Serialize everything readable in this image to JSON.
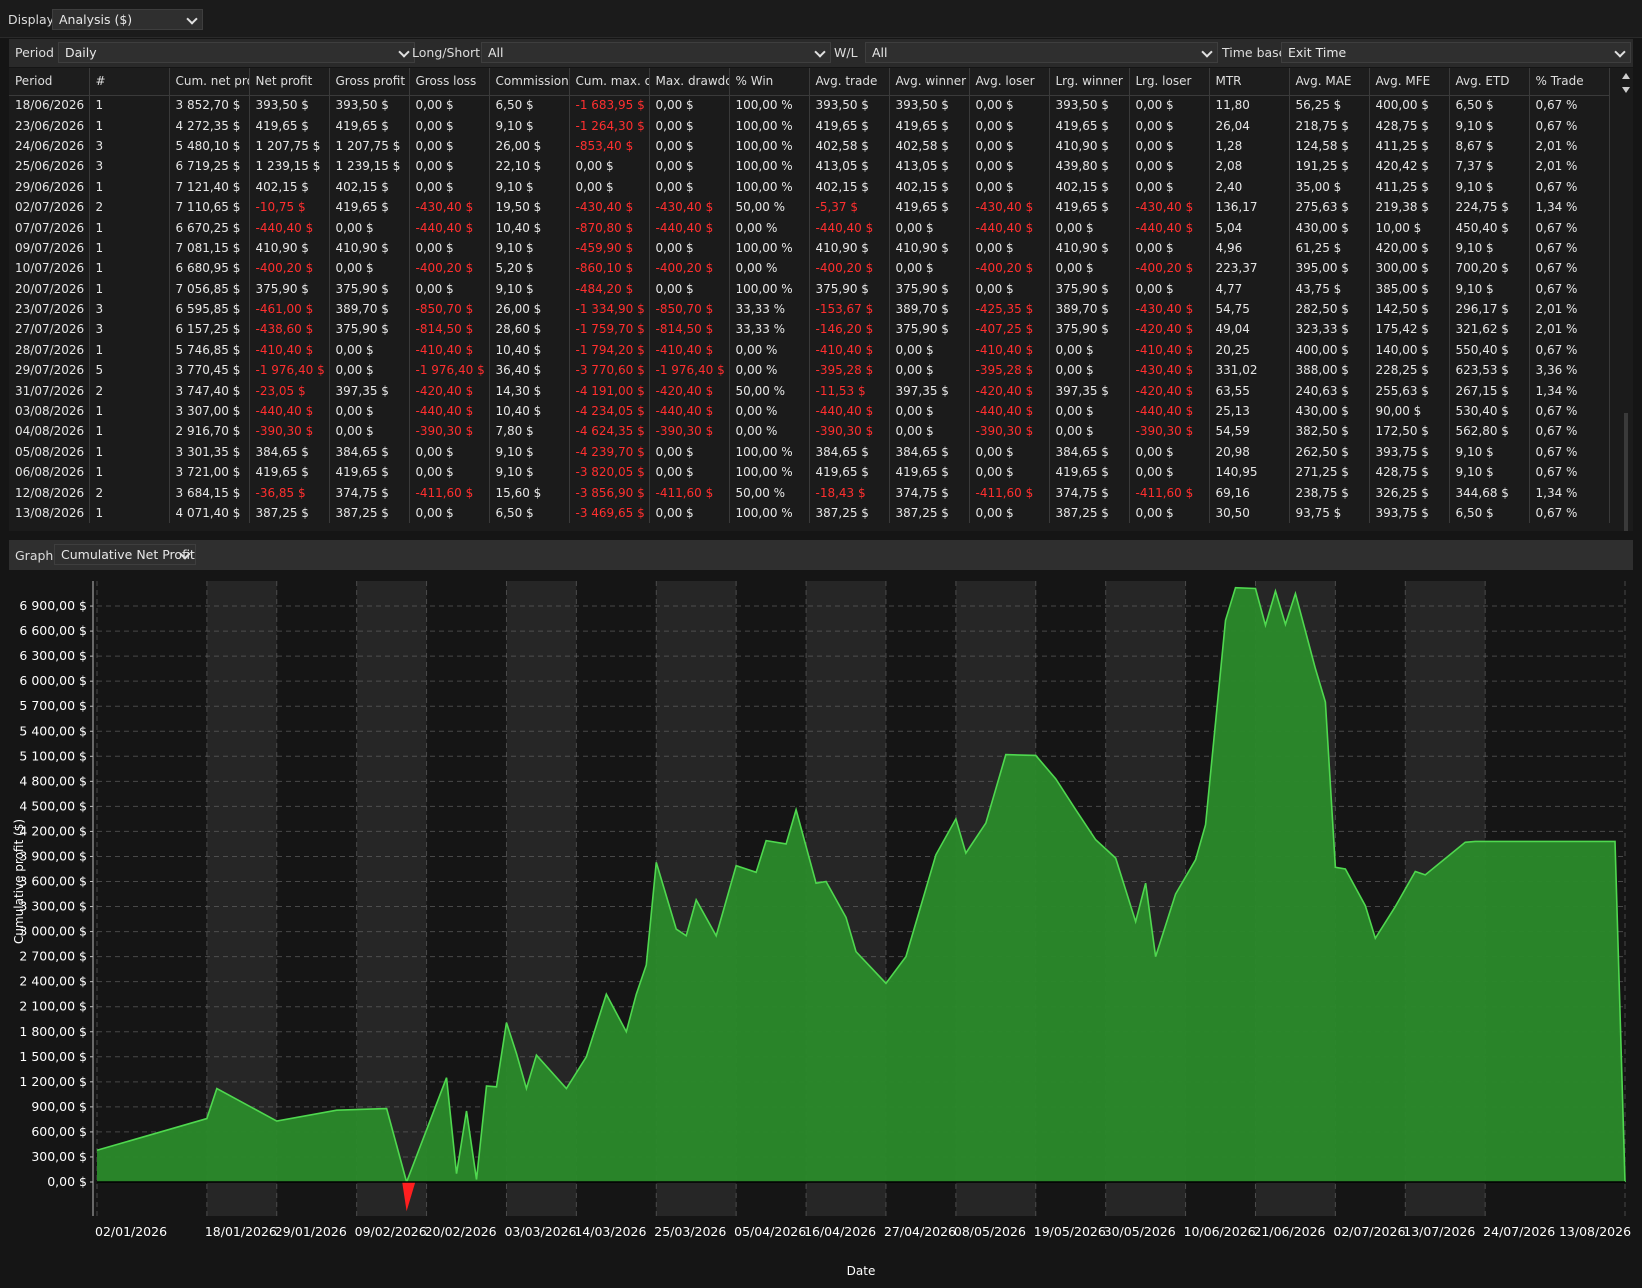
{
  "display": {
    "label": "Display",
    "value": "Analysis ($)"
  },
  "filters": [
    {
      "label": "Period",
      "value": "Daily"
    },
    {
      "label": "Long/Short",
      "value": "All"
    },
    {
      "label": "W/L",
      "value": "All"
    },
    {
      "label": "Time base",
      "value": "Exit Time"
    }
  ],
  "table": {
    "columns": [
      "Period",
      "#",
      "Cum. net pro",
      "Net profit",
      "Gross profit",
      "Gross loss",
      "Commission",
      "Cum. max. dr",
      "Max. drawdo",
      "% Win",
      "Avg. trade",
      "Avg. winner",
      "Avg. loser",
      "Lrg. winner",
      "Lrg. loser",
      "MTR",
      "Avg. MAE",
      "Avg. MFE",
      "Avg. ETD",
      "% Trade"
    ],
    "rows": [
      [
        "18/06/2026",
        "1",
        "3 852,70 $",
        "393,50 $",
        "393,50 $",
        "0,00 $",
        "6,50 $",
        "-1 683,95 $",
        "0,00 $",
        "100,00 %",
        "393,50 $",
        "393,50 $",
        "0,00 $",
        "393,50 $",
        "0,00 $",
        "11,80",
        "56,25 $",
        "400,00 $",
        "6,50 $",
        "0,67 %"
      ],
      [
        "23/06/2026",
        "1",
        "4 272,35 $",
        "419,65 $",
        "419,65 $",
        "0,00 $",
        "9,10 $",
        "-1 264,30 $",
        "0,00 $",
        "100,00 %",
        "419,65 $",
        "419,65 $",
        "0,00 $",
        "419,65 $",
        "0,00 $",
        "26,04",
        "218,75 $",
        "428,75 $",
        "9,10 $",
        "0,67 %"
      ],
      [
        "24/06/2026",
        "3",
        "5 480,10 $",
        "1 207,75 $",
        "1 207,75 $",
        "0,00 $",
        "26,00 $",
        "-853,40 $",
        "0,00 $",
        "100,00 %",
        "402,58 $",
        "402,58 $",
        "0,00 $",
        "410,90 $",
        "0,00 $",
        "1,28",
        "124,58 $",
        "411,25 $",
        "8,67 $",
        "2,01 %"
      ],
      [
        "25/06/2026",
        "3",
        "6 719,25 $",
        "1 239,15 $",
        "1 239,15 $",
        "0,00 $",
        "22,10 $",
        "0,00 $",
        "0,00 $",
        "100,00 %",
        "413,05 $",
        "413,05 $",
        "0,00 $",
        "439,80 $",
        "0,00 $",
        "2,08",
        "191,25 $",
        "420,42 $",
        "7,37 $",
        "2,01 %"
      ],
      [
        "29/06/2026",
        "1",
        "7 121,40 $",
        "402,15 $",
        "402,15 $",
        "0,00 $",
        "9,10 $",
        "0,00 $",
        "0,00 $",
        "100,00 %",
        "402,15 $",
        "402,15 $",
        "0,00 $",
        "402,15 $",
        "0,00 $",
        "2,40",
        "35,00 $",
        "411,25 $",
        "9,10 $",
        "0,67 %"
      ],
      [
        "02/07/2026",
        "2",
        "7 110,65 $",
        "-10,75 $",
        "419,65 $",
        "-430,40 $",
        "19,50 $",
        "-430,40 $",
        "-430,40 $",
        "50,00 %",
        "-5,37 $",
        "419,65 $",
        "-430,40 $",
        "419,65 $",
        "-430,40 $",
        "136,17",
        "275,63 $",
        "219,38 $",
        "224,75 $",
        "1,34 %"
      ],
      [
        "07/07/2026",
        "1",
        "6 670,25 $",
        "-440,40 $",
        "0,00 $",
        "-440,40 $",
        "10,40 $",
        "-870,80 $",
        "-440,40 $",
        "0,00 %",
        "-440,40 $",
        "0,00 $",
        "-440,40 $",
        "0,00 $",
        "-440,40 $",
        "5,04",
        "430,00 $",
        "10,00 $",
        "450,40 $",
        "0,67 %"
      ],
      [
        "09/07/2026",
        "1",
        "7 081,15 $",
        "410,90 $",
        "410,90 $",
        "0,00 $",
        "9,10 $",
        "-459,90 $",
        "0,00 $",
        "100,00 %",
        "410,90 $",
        "410,90 $",
        "0,00 $",
        "410,90 $",
        "0,00 $",
        "4,96",
        "61,25 $",
        "420,00 $",
        "9,10 $",
        "0,67 %"
      ],
      [
        "10/07/2026",
        "1",
        "6 680,95 $",
        "-400,20 $",
        "0,00 $",
        "-400,20 $",
        "5,20 $",
        "-860,10 $",
        "-400,20 $",
        "0,00 %",
        "-400,20 $",
        "0,00 $",
        "-400,20 $",
        "0,00 $",
        "-400,20 $",
        "223,37",
        "395,00 $",
        "300,00 $",
        "700,20 $",
        "0,67 %"
      ],
      [
        "20/07/2026",
        "1",
        "7 056,85 $",
        "375,90 $",
        "375,90 $",
        "0,00 $",
        "9,10 $",
        "-484,20 $",
        "0,00 $",
        "100,00 %",
        "375,90 $",
        "375,90 $",
        "0,00 $",
        "375,90 $",
        "0,00 $",
        "4,77",
        "43,75 $",
        "385,00 $",
        "9,10 $",
        "0,67 %"
      ],
      [
        "23/07/2026",
        "3",
        "6 595,85 $",
        "-461,00 $",
        "389,70 $",
        "-850,70 $",
        "26,00 $",
        "-1 334,90 $",
        "-850,70 $",
        "33,33 %",
        "-153,67 $",
        "389,70 $",
        "-425,35 $",
        "389,70 $",
        "-430,40 $",
        "54,75",
        "282,50 $",
        "142,50 $",
        "296,17 $",
        "2,01 %"
      ],
      [
        "27/07/2026",
        "3",
        "6 157,25 $",
        "-438,60 $",
        "375,90 $",
        "-814,50 $",
        "28,60 $",
        "-1 759,70 $",
        "-814,50 $",
        "33,33 %",
        "-146,20 $",
        "375,90 $",
        "-407,25 $",
        "375,90 $",
        "-420,40 $",
        "49,04",
        "323,33 $",
        "175,42 $",
        "321,62 $",
        "2,01 %"
      ],
      [
        "28/07/2026",
        "1",
        "5 746,85 $",
        "-410,40 $",
        "0,00 $",
        "-410,40 $",
        "10,40 $",
        "-1 794,20 $",
        "-410,40 $",
        "0,00 %",
        "-410,40 $",
        "0,00 $",
        "-410,40 $",
        "0,00 $",
        "-410,40 $",
        "20,25",
        "400,00 $",
        "140,00 $",
        "550,40 $",
        "0,67 %"
      ],
      [
        "29/07/2026",
        "5",
        "3 770,45 $",
        "-1 976,40 $",
        "0,00 $",
        "-1 976,40 $",
        "36,40 $",
        "-3 770,60 $",
        "-1 976,40 $",
        "0,00 %",
        "-395,28 $",
        "0,00 $",
        "-395,28 $",
        "0,00 $",
        "-430,40 $",
        "331,02",
        "388,00 $",
        "228,25 $",
        "623,53 $",
        "3,36 %"
      ],
      [
        "31/07/2026",
        "2",
        "3 747,40 $",
        "-23,05 $",
        "397,35 $",
        "-420,40 $",
        "14,30 $",
        "-4 191,00 $",
        "-420,40 $",
        "50,00 %",
        "-11,53 $",
        "397,35 $",
        "-420,40 $",
        "397,35 $",
        "-420,40 $",
        "63,55",
        "240,63 $",
        "255,63 $",
        "267,15 $",
        "1,34 %"
      ],
      [
        "03/08/2026",
        "1",
        "3 307,00 $",
        "-440,40 $",
        "0,00 $",
        "-440,40 $",
        "10,40 $",
        "-4 234,05 $",
        "-440,40 $",
        "0,00 %",
        "-440,40 $",
        "0,00 $",
        "-440,40 $",
        "0,00 $",
        "-440,40 $",
        "25,13",
        "430,00 $",
        "90,00 $",
        "530,40 $",
        "0,67 %"
      ],
      [
        "04/08/2026",
        "1",
        "2 916,70 $",
        "-390,30 $",
        "0,00 $",
        "-390,30 $",
        "7,80 $",
        "-4 624,35 $",
        "-390,30 $",
        "0,00 %",
        "-390,30 $",
        "0,00 $",
        "-390,30 $",
        "0,00 $",
        "-390,30 $",
        "54,59",
        "382,50 $",
        "172,50 $",
        "562,80 $",
        "0,67 %"
      ],
      [
        "05/08/2026",
        "1",
        "3 301,35 $",
        "384,65 $",
        "384,65 $",
        "0,00 $",
        "9,10 $",
        "-4 239,70 $",
        "0,00 $",
        "100,00 %",
        "384,65 $",
        "384,65 $",
        "0,00 $",
        "384,65 $",
        "0,00 $",
        "20,98",
        "262,50 $",
        "393,75 $",
        "9,10 $",
        "0,67 %"
      ],
      [
        "06/08/2026",
        "1",
        "3 721,00 $",
        "419,65 $",
        "419,65 $",
        "0,00 $",
        "9,10 $",
        "-3 820,05 $",
        "0,00 $",
        "100,00 %",
        "419,65 $",
        "419,65 $",
        "0,00 $",
        "419,65 $",
        "0,00 $",
        "140,95",
        "271,25 $",
        "428,75 $",
        "9,10 $",
        "0,67 %"
      ],
      [
        "12/08/2026",
        "2",
        "3 684,15 $",
        "-36,85 $",
        "374,75 $",
        "-411,60 $",
        "15,60 $",
        "-3 856,90 $",
        "-411,60 $",
        "50,00 %",
        "-18,43 $",
        "374,75 $",
        "-411,60 $",
        "374,75 $",
        "-411,60 $",
        "69,16",
        "238,75 $",
        "326,25 $",
        "344,68 $",
        "1,34 %"
      ],
      [
        "13/08/2026",
        "1",
        "4 071,40 $",
        "387,25 $",
        "387,25 $",
        "0,00 $",
        "6,50 $",
        "-3 469,65 $",
        "0,00 $",
        "100,00 %",
        "387,25 $",
        "387,25 $",
        "0,00 $",
        "387,25 $",
        "0,00 $",
        "30,50",
        "93,75 $",
        "393,75 $",
        "6,50 $",
        "0,67 %"
      ]
    ]
  },
  "graph": {
    "label": "Graph",
    "value": "Cumulative Net Profit"
  },
  "colors": {
    "area": "#2a8a2a",
    "line": "#4fd84f",
    "negative": "#ff1f1f",
    "neg_text": "#ff2f2f"
  },
  "chart_data": {
    "type": "area",
    "ylabel": "Cumulative profit ($)",
    "xlabel": "Date",
    "ylim": [
      0,
      7200
    ],
    "yticks": [
      "0,00 $",
      "300,00 $",
      "600,00 $",
      "900,00 $",
      "1 200,00 $",
      "1 500,00 $",
      "1 800,00 $",
      "2 100,00 $",
      "2 400,00 $",
      "2 700,00 $",
      "3 000,00 $",
      "3 300,00 $",
      "3 600,00 $",
      "3 900,00 $",
      "4 200,00 $",
      "4 500,00 $",
      "4 800,00 $",
      "5 100,00 $",
      "5 400,00 $",
      "5 700,00 $",
      "6 000,00 $",
      "6 300,00 $",
      "6 600,00 $",
      "6 900,00 $"
    ],
    "xticks": [
      "02/01/2026",
      "18/01/2026",
      "29/01/2026",
      "09/02/2026",
      "20/02/2026",
      "03/03/2026",
      "14/03/2026",
      "25/03/2026",
      "05/04/2026",
      "16/04/2026",
      "27/04/2026",
      "08/05/2026",
      "19/05/2026",
      "30/05/2026",
      "10/06/2026",
      "21/06/2026",
      "02/07/2026",
      "13/07/2026",
      "24/07/2026",
      "13/08/2026"
    ],
    "x": [
      0,
      11,
      12,
      18,
      24,
      29,
      30,
      31,
      35,
      36,
      37,
      38,
      39,
      40,
      41,
      42,
      43,
      44,
      47,
      49,
      51,
      53,
      54,
      55,
      56,
      58,
      59,
      60,
      62,
      64,
      66,
      67,
      69,
      70,
      72,
      73,
      75,
      76,
      79,
      81,
      84,
      86,
      87,
      89,
      91,
      94,
      96,
      98,
      100,
      102,
      104,
      105,
      106,
      108,
      110,
      111,
      113,
      114,
      116,
      117,
      118,
      119,
      120,
      121,
      122,
      123,
      124,
      125,
      127,
      128,
      130,
      132,
      133,
      137,
      138,
      139,
      140,
      141,
      143,
      144,
      145,
      146,
      147,
      150,
      152,
      153
    ],
    "y": [
      380,
      760,
      1120,
      730,
      860,
      880,
      440,
      -350,
      1250,
      100,
      850,
      30,
      1150,
      1140,
      1910,
      1540,
      1120,
      1520,
      1120,
      1500,
      2250,
      1800,
      2250,
      2600,
      3830,
      3030,
      2950,
      3380,
      2950,
      3790,
      3710,
      4090,
      4050,
      4460,
      3580,
      3600,
      3170,
      2760,
      2380,
      2700,
      3920,
      4350,
      3940,
      4300,
      5120,
      5110,
      4830,
      4460,
      4100,
      3880,
      3120,
      3580,
      2700,
      3450,
      3860,
      4280,
      6730,
      7120,
      7110,
      6670,
      7080,
      6680,
      7050,
      6600,
      6150,
      5750,
      3770,
      3750,
      3310,
      2920,
      3300,
      3720,
      3680,
      4070,
      4080,
      4080,
      4080,
      4080,
      4080,
      4080,
      4080,
      4080,
      4080,
      4080,
      4080,
      0
    ]
  }
}
